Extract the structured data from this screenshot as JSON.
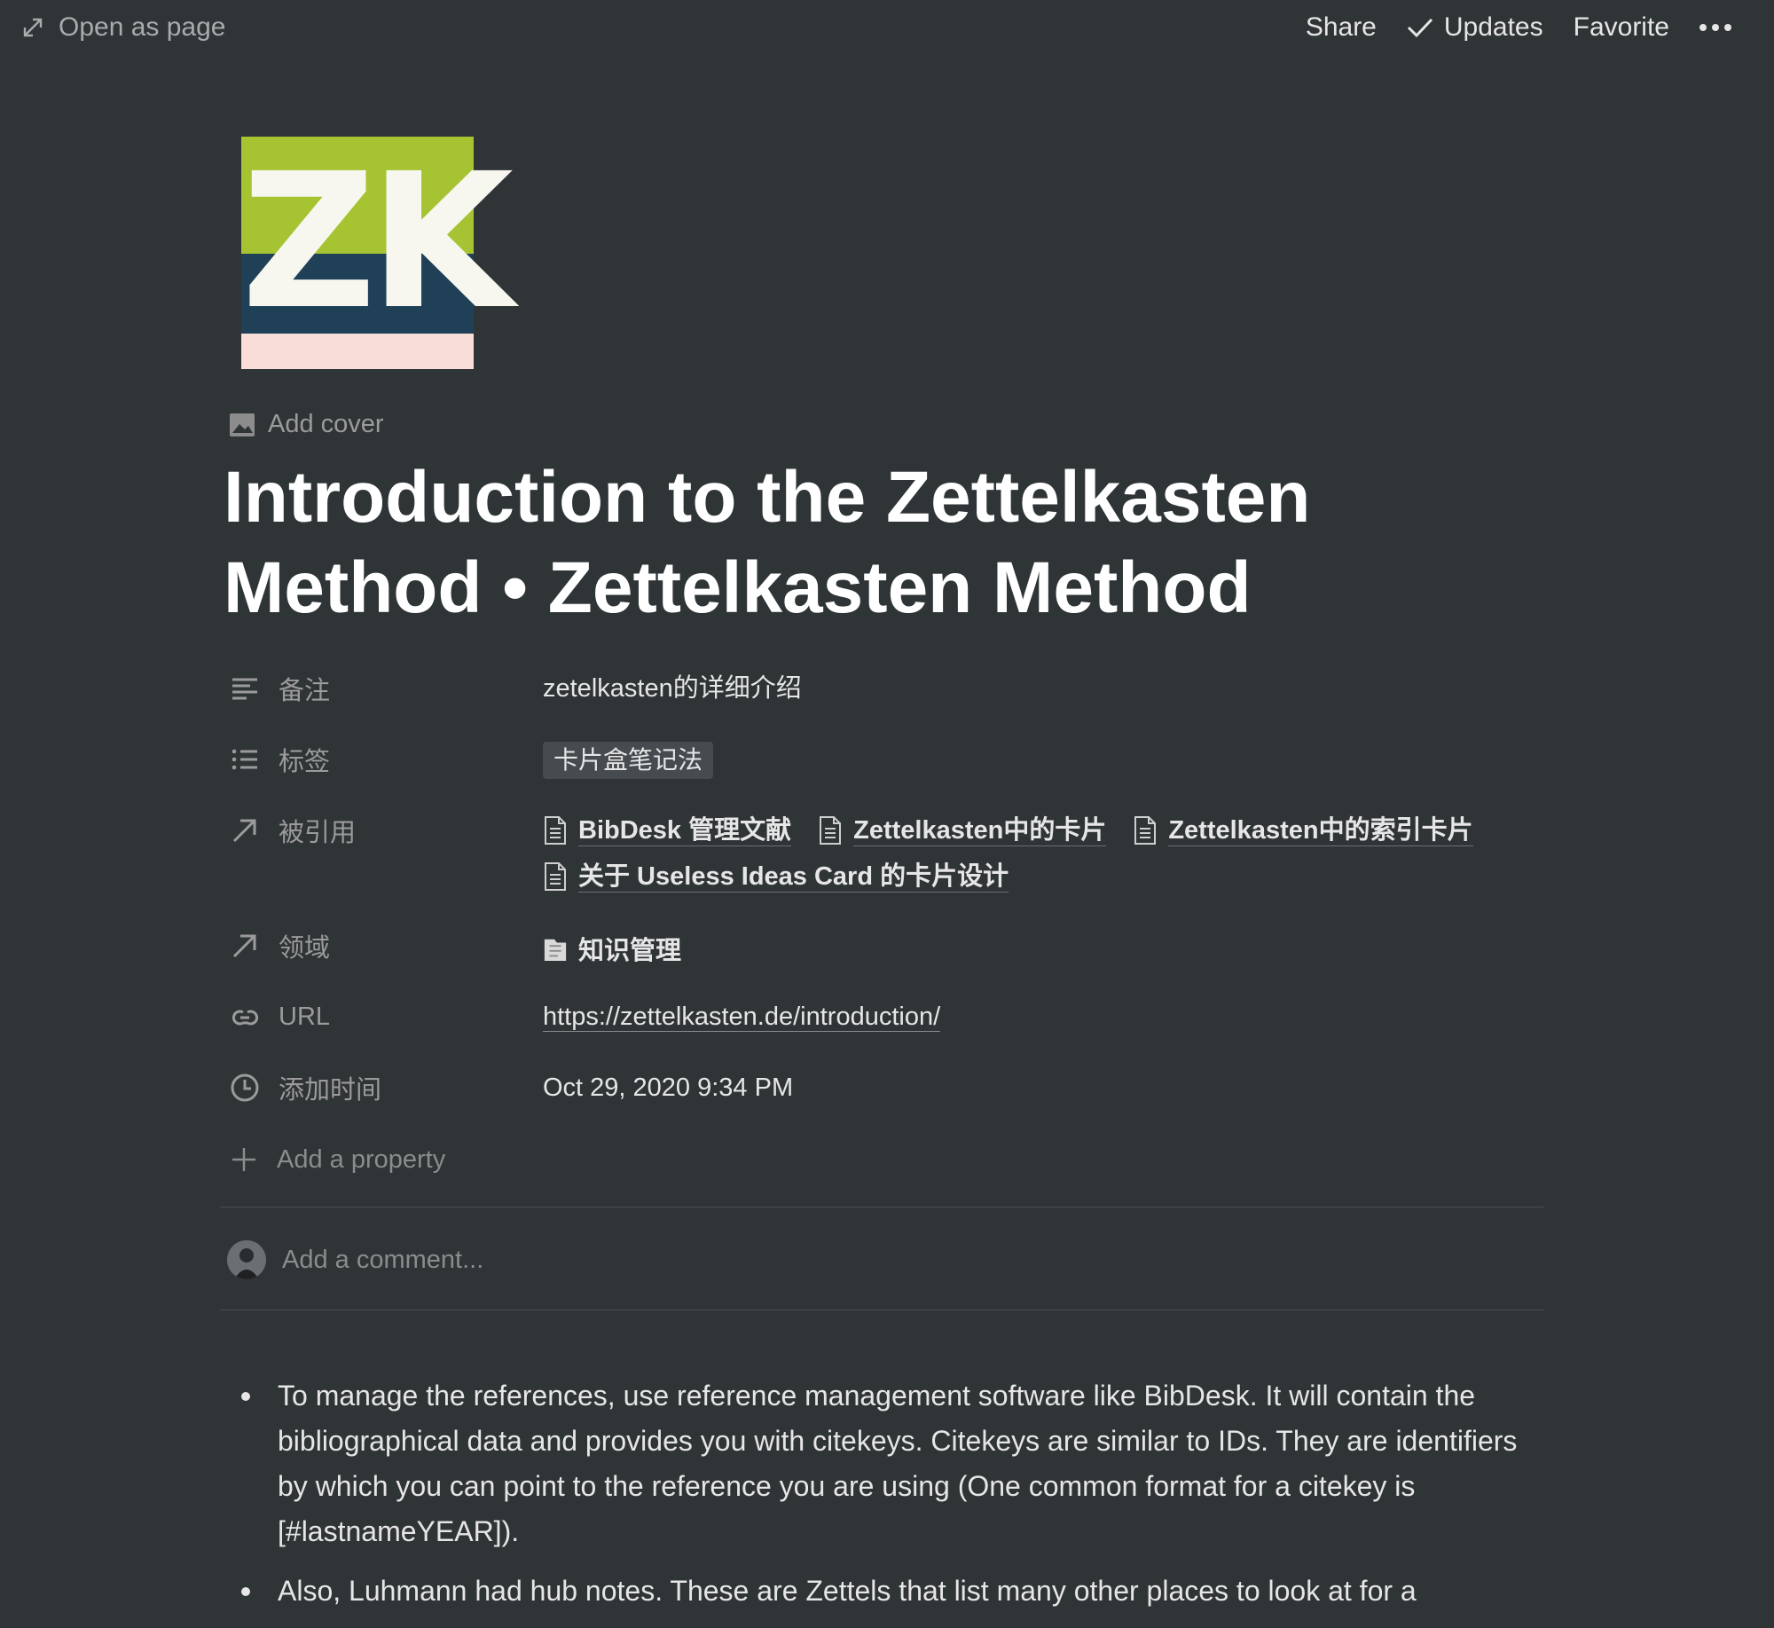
{
  "topbar": {
    "open_as_page": "Open as page",
    "share": "Share",
    "updates": "Updates",
    "favorite": "Favorite"
  },
  "page_icon": {
    "text": "ZK",
    "colors": {
      "top": "#a6c332",
      "middle": "#1f4057",
      "bottom": "#f8ded6"
    }
  },
  "add_cover": "Add cover",
  "title": "Introduction to the Zettelkasten Method • Zettelkasten Method",
  "properties": {
    "note": {
      "name": "备注",
      "value": "zetelkasten的详细介绍",
      "icon": "text-lines-icon"
    },
    "tags": {
      "name": "标签",
      "value": "卡片盒笔记法",
      "icon": "list-icon"
    },
    "cited_by": {
      "name": "被引用",
      "icon": "arrow-up-right-icon",
      "items": [
        "BibDesk 管理文献",
        "Zettelkasten中的卡片",
        "Zettelkasten中的索引卡片",
        "关于 Useless Ideas Card 的卡片设计"
      ]
    },
    "domain": {
      "name": "领域",
      "value": "知识管理",
      "icon": "arrow-up-right-icon"
    },
    "url": {
      "name": "URL",
      "value": "https://zettelkasten.de/introduction/",
      "icon": "link-icon"
    },
    "added_time": {
      "name": "添加时间",
      "value": "Oct 29, 2020 9:34 PM",
      "icon": "clock-icon"
    }
  },
  "add_property": "Add a property",
  "comment_placeholder": "Add a comment...",
  "body": {
    "bullets": [
      "To manage the references, use reference management software like BibDesk. It will contain the bibliographical data and provides you with citekeys. Citekeys are similar to IDs. They are identifiers by which you can point to the reference you are using (One common format for a citekey is [#lastnameYEAR]).",
      "Also, Luhmann had hub notes. These are Zettels that list many other places to look at for a"
    ]
  }
}
